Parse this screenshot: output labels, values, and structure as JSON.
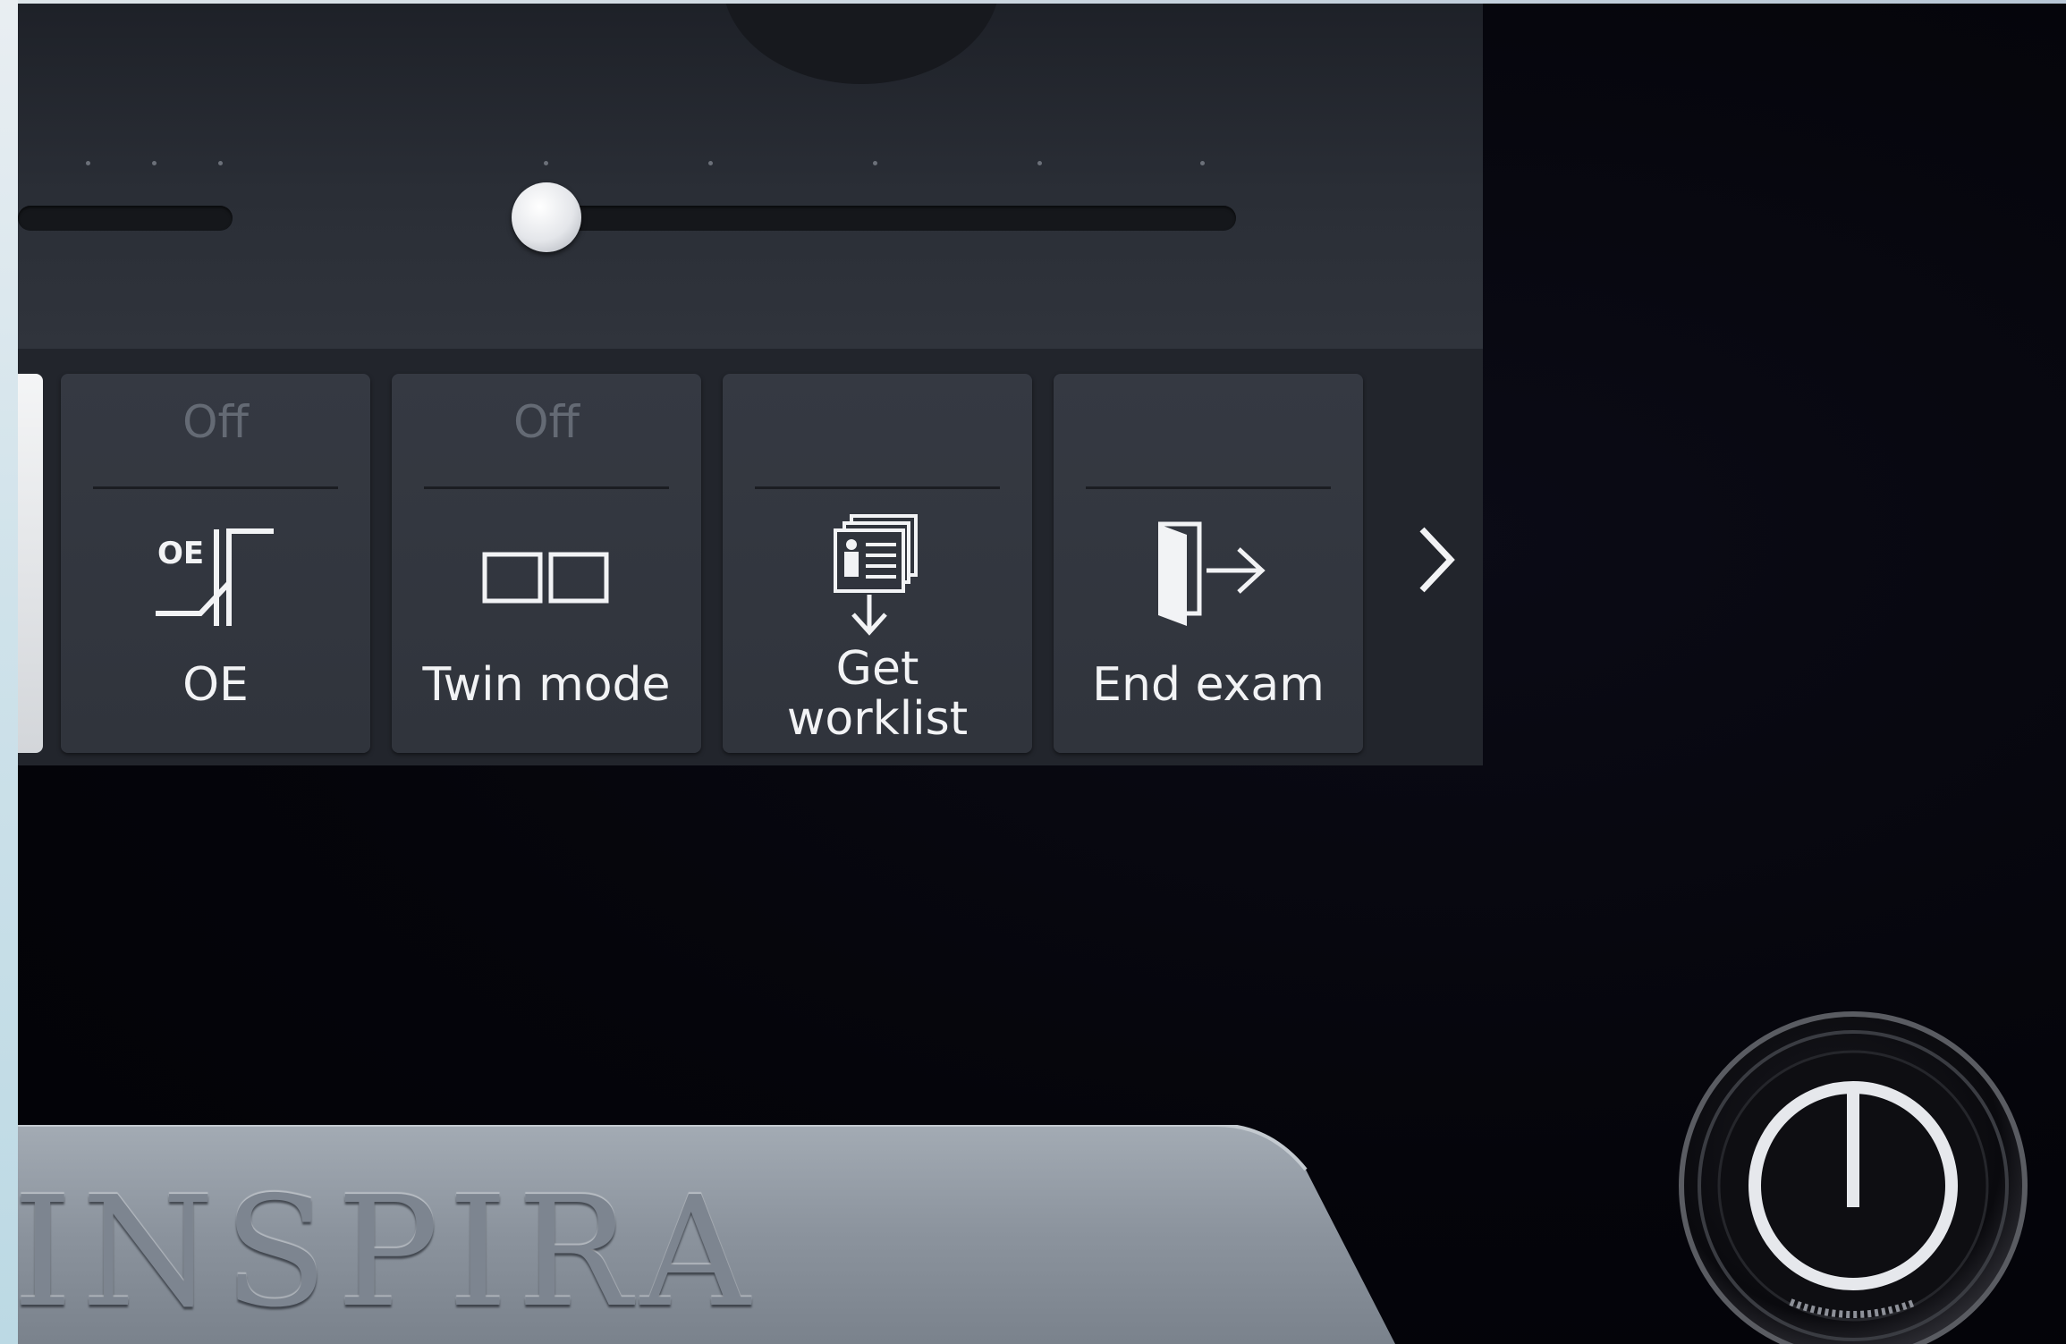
{
  "toolbar": {
    "tiles": [
      {
        "state": "Off",
        "label": "OE",
        "icon": "oe-curve-icon"
      },
      {
        "state": "Off",
        "label": "Twin mode",
        "icon": "twin-screen-icon"
      },
      {
        "state": "",
        "label_line1": "Get",
        "label_line2": "worklist",
        "icon": "worklist-download-icon"
      },
      {
        "state": "",
        "label": "End exam",
        "icon": "exit-door-icon"
      }
    ],
    "next_icon": "chevron-right-icon"
  },
  "icons": {
    "oe_icon_text": "OE"
  },
  "slider": {
    "level": 0.0
  },
  "device": {
    "brand": "INSPIRA",
    "power_icon": "power-icon"
  },
  "colors": {
    "screen_bg": "#262a32",
    "tile_bg": "#353942",
    "tile_text": "#f2f3f5",
    "state_text": "#646a74",
    "housing": "#8b939d"
  }
}
